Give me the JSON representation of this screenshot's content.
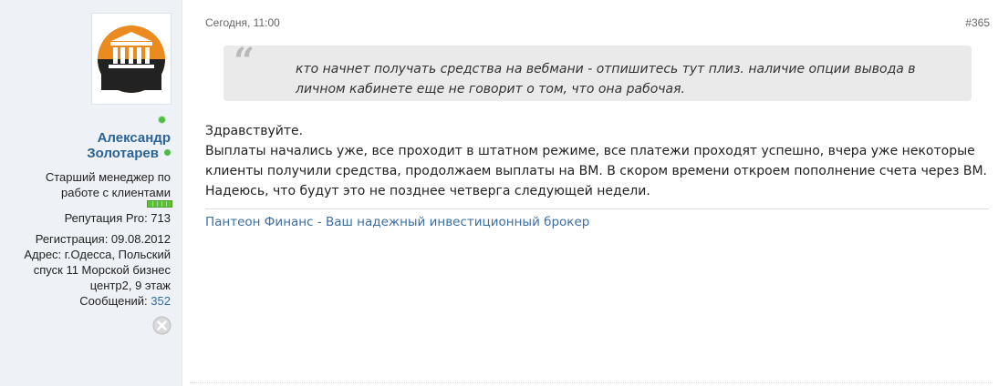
{
  "user": {
    "name_line1": "Александр",
    "name_line2": "Золотарев",
    "title_line1": "Старший менеджер по",
    "title_line2": "работе с клиентами",
    "reputation": "Репутация Pro: 713",
    "registration": "Регистрация: 09.08.2012",
    "address_line1": "Адрес: г.Одесса, Польский",
    "address_line2": "спуск 11 Морской бизнес",
    "address_line3": "центр2, 9 этаж",
    "messages_label": "Сообщений:",
    "messages_count": "352",
    "avatar_icon": "pantheon-building-logo-icon",
    "online_color": "#4dbb45"
  },
  "post": {
    "date": "Сегодня, 11:00",
    "number": "#365",
    "quote": "кто начнет получать средства на вебмани - отпишитесь тут плиз. наличие опции вывода в личном кабинете еще не говорит о том, что она рабочая.",
    "greeting": "Здравствуйте.",
    "body": "Выплаты начались уже, все проходит в штатном режиме, все платежи проходят успешно, вчера уже некоторые клиенты получили средства, продолжаем выплаты на ВМ. В скором времени откроем пополнение счета через ВМ. Надеюсь, что будут это не позднее четверга следующей недели.",
    "signature": "Пантеон Финанс - Ваш надежный инвестиционный брокер"
  }
}
